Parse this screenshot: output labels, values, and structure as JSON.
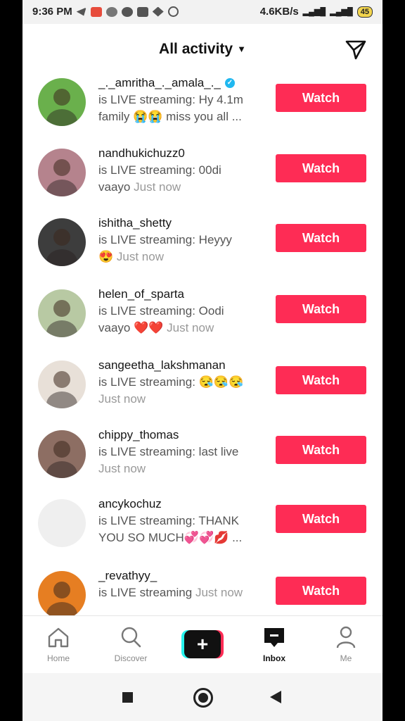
{
  "status_bar": {
    "time": "9:36 PM",
    "speed": "4.6KB/s",
    "battery": "45"
  },
  "header": {
    "title": "All activity"
  },
  "activities": [
    {
      "username": "_._amritha_._amala_._",
      "verified": true,
      "line1": "is LIVE streaming: Hy 4.1m",
      "line2": "family 😭😭 miss you all ...",
      "time": "",
      "watch": "Watch",
      "avatar_color": "#6ab04c"
    },
    {
      "username": "nandhukichuzz0",
      "verified": false,
      "line1": "is LIVE streaming: 00di",
      "line2": "vaayo",
      "time": "Just now",
      "watch": "Watch",
      "avatar_color": "#b5838d"
    },
    {
      "username": "ishitha_shetty",
      "verified": false,
      "line1": "is LIVE streaming: Heyyy",
      "line2": "😍",
      "time": "Just now",
      "watch": "Watch",
      "avatar_color": "#3d3d3d"
    },
    {
      "username": "helen_of_sparta",
      "verified": false,
      "line1": "is LIVE streaming: Oodi",
      "line2": "vaayo ❤️❤️",
      "time": "Just now",
      "watch": "Watch",
      "avatar_color": "#b8c9a3"
    },
    {
      "username": "sangeetha_lakshmanan",
      "verified": false,
      "line1": "is LIVE streaming: 😪😪😪",
      "line2": "",
      "time": "Just now",
      "watch": "Watch",
      "avatar_color": "#e8e0d8"
    },
    {
      "username": "chippy_thomas",
      "verified": false,
      "line1": "is LIVE streaming: last live",
      "line2": "",
      "time": "Just now",
      "watch": "Watch",
      "avatar_color": "#8d6e63"
    },
    {
      "username": "ancykochuz",
      "verified": false,
      "line1": "is LIVE streaming: THANK",
      "line2": "YOU SO MUCH💞💞💋 ...",
      "time": "",
      "watch": "Watch",
      "avatar_color": "#efefef"
    },
    {
      "username": "_revathyy_",
      "verified": false,
      "line1": "is LIVE streaming",
      "line2": "",
      "time": "Just now",
      "watch": "Watch",
      "avatar_color": "#e67e22"
    }
  ],
  "bottom_nav": {
    "home": "Home",
    "discover": "Discover",
    "inbox": "Inbox",
    "me": "Me",
    "active": "Inbox"
  }
}
